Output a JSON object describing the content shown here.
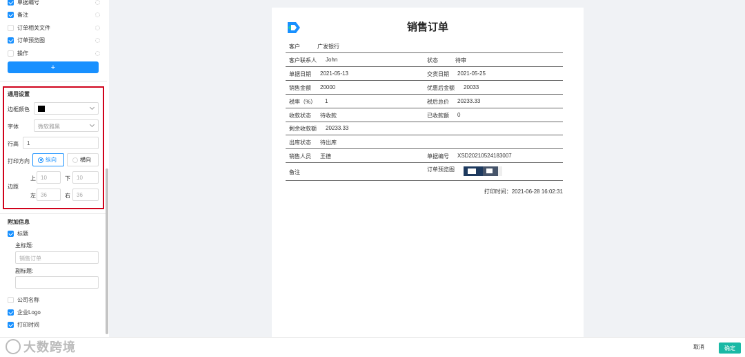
{
  "field_list": [
    {
      "label": "单据编号",
      "checked": true
    },
    {
      "label": "备注",
      "checked": true
    },
    {
      "label": "订单相关文件",
      "checked": false
    },
    {
      "label": "订单预览图",
      "checked": true
    },
    {
      "label": "操作",
      "checked": false
    }
  ],
  "add_button": "+",
  "general": {
    "title": "通用设置",
    "border_color_label": "边框颜色",
    "border_color": "#000000",
    "font_label": "字体",
    "font_value": "微软雅黑",
    "line_height_label": "行高",
    "line_height": "1",
    "direction_label": "打印方向",
    "direction_options": [
      "纵向",
      "横向"
    ],
    "direction_selected": "纵向",
    "margin_label": "边距",
    "margin_top_label": "上",
    "margin_top": "10",
    "margin_bottom_label": "下",
    "margin_bottom": "10",
    "margin_left_label": "左",
    "margin_left": "36",
    "margin_right_label": "右",
    "margin_right": "36"
  },
  "extra": {
    "title": "附加信息",
    "title_checkbox": "标题",
    "main_title_label": "主标题:",
    "main_title_placeholder": "销售订单",
    "sub_title_label": "副标题:",
    "sub_title_value": "",
    "company_name": "公司名称",
    "company_logo": "企业Logo",
    "print_time": "打印时间"
  },
  "document": {
    "title": "销售订单",
    "customer_label": "客户",
    "customer": "广发银行",
    "contact_label": "客户联系人",
    "contact": "John",
    "status_label": "状态",
    "status": "待审",
    "date_label": "单据日期",
    "date": "2021-05-13",
    "delivery_label": "交货日期",
    "delivery": "2021-05-25",
    "amount_label": "销售金额",
    "amount": "20000",
    "discounted_label": "优惠后金额",
    "discounted": "20033",
    "tax_label": "税率（%）",
    "tax": "1",
    "after_tax_label": "税后总价",
    "after_tax": "20233.33",
    "collect_status_label": "收款状态",
    "collect_status": "待收款",
    "collected_label": "已收款额",
    "collected": "0",
    "remaining_label": "剩余收款额",
    "remaining": "20233.33",
    "warehouse_label": "出库状态",
    "warehouse": "待出库",
    "sales_label": "销售人员",
    "sales": "王德",
    "doc_no_label": "单据编号",
    "doc_no": "XSD20210524183007",
    "note_label": "备注",
    "preview_label": "订单预览图",
    "print_time": "打印时间：2021-06-28 16:02:31"
  },
  "footer": {
    "watermark": "大数跨境",
    "cancel": "取消",
    "confirm": "确定"
  },
  "colors": {
    "primary": "#1890ff",
    "confirm": "#19b9a5",
    "highlight": "#d0021b"
  }
}
